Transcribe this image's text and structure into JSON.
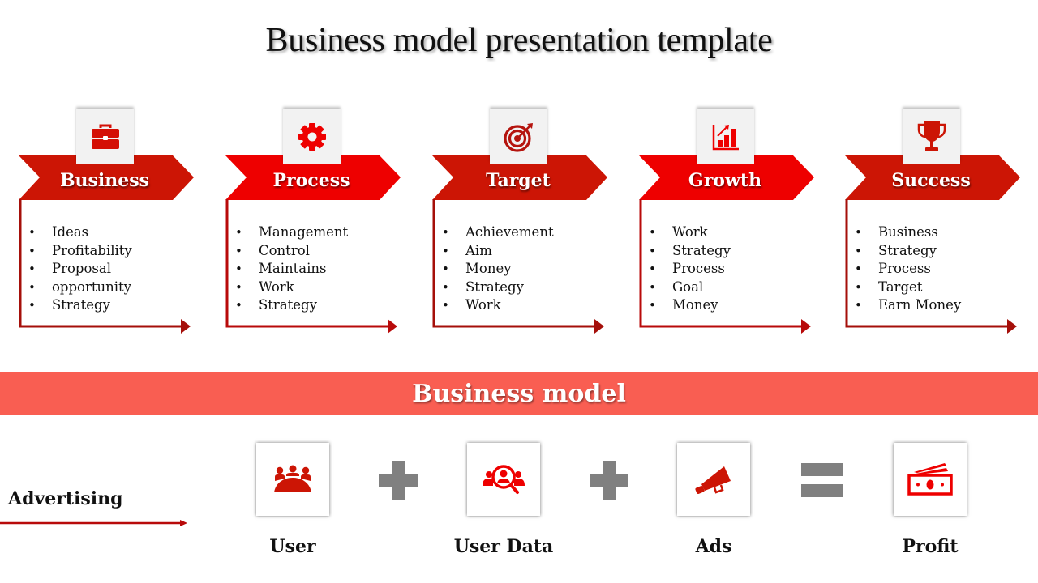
{
  "title": "Business model presentation template",
  "colors": {
    "chevron_dark": "#CC1505",
    "chevron_bright": "#EE0000",
    "bracket": "#A50F0A",
    "banner": "#F95E52",
    "operator_gray": "#808080",
    "icon_red": "#D40F05"
  },
  "steps": [
    {
      "label": "Business",
      "icon": "briefcase-icon",
      "items": [
        "Ideas",
        "Profitability",
        "Proposal",
        "opportunity",
        "Strategy"
      ]
    },
    {
      "label": "Process",
      "icon": "gear-icon",
      "items": [
        "Management",
        "Control",
        "Maintains",
        "Work",
        "Strategy"
      ]
    },
    {
      "label": "Target",
      "icon": "target-icon",
      "items": [
        "Achievement",
        "Aim",
        "Money",
        "Strategy",
        "Work"
      ]
    },
    {
      "label": "Growth",
      "icon": "growth-chart-icon",
      "items": [
        "Work",
        "Strategy",
        "Process",
        "Goal",
        "Money"
      ]
    },
    {
      "label": "Success",
      "icon": "trophy-icon",
      "items": [
        "Business",
        "Strategy",
        "Process",
        "Target",
        "Earn Money"
      ]
    }
  ],
  "banner": {
    "label": "Business model"
  },
  "equation": {
    "lead_label": "Advertising",
    "terms": [
      {
        "label": "User",
        "icon": "meeting-group-icon"
      },
      {
        "label": "User Data",
        "icon": "user-search-icon"
      },
      {
        "label": "Ads",
        "icon": "megaphone-icon"
      },
      {
        "label": "Profit",
        "icon": "cash-icon"
      }
    ],
    "operators": [
      "plus",
      "plus",
      "equals"
    ]
  }
}
